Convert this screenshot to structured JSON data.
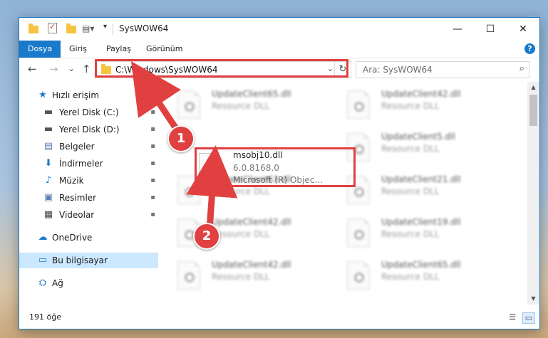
{
  "window": {
    "title": "SysWOW64",
    "minimize_symbol": "—",
    "maximize_symbol": "☐",
    "close_symbol": "✕"
  },
  "ribbon": {
    "tabs": [
      "Dosya",
      "Giriş",
      "Paylaş",
      "Görünüm"
    ],
    "active_tab": "Dosya",
    "help": "?"
  },
  "nav": {
    "back": "←",
    "forward": "→",
    "recent": "⌄",
    "up": "↑",
    "address": "C:\\Windows\\SysWOW64",
    "refresh": "↻",
    "dropdown": "⌄"
  },
  "search": {
    "placeholder": "Ara: SysWOW64",
    "icon": "⌕"
  },
  "sidebar": {
    "items": [
      {
        "label": "Hızlı erişim",
        "icon": "star-icon",
        "glyph": "★",
        "color": "#1979ca",
        "pinned": false
      },
      {
        "label": "Yerel Disk (C:)",
        "icon": "drive-icon",
        "glyph": "▬",
        "color": "#555555",
        "pinned": true
      },
      {
        "label": "Yerel Disk (D:)",
        "icon": "drive-icon",
        "glyph": "▬",
        "color": "#555555",
        "pinned": true
      },
      {
        "label": "Belgeler",
        "icon": "documents-icon",
        "glyph": "▤",
        "color": "#5a7fb3",
        "pinned": true
      },
      {
        "label": "İndirmeler",
        "icon": "downloads-icon",
        "glyph": "⬇",
        "color": "#1979ca",
        "pinned": true
      },
      {
        "label": "Müzik",
        "icon": "music-icon",
        "glyph": "♪",
        "color": "#1979ca",
        "pinned": true
      },
      {
        "label": "Resimler",
        "icon": "pictures-icon",
        "glyph": "▣",
        "color": "#5a7fb3",
        "pinned": true
      },
      {
        "label": "Videolar",
        "icon": "videos-icon",
        "glyph": "▦",
        "color": "#444444",
        "pinned": true
      },
      {
        "label": "OneDrive",
        "icon": "onedrive-icon",
        "glyph": "☁",
        "color": "#1979ca",
        "pinned": false
      },
      {
        "label": "Bu bilgisayar",
        "icon": "computer-icon",
        "glyph": "▭",
        "color": "#2b79c2",
        "pinned": false
      },
      {
        "label": "Ağ",
        "icon": "network-icon",
        "glyph": "⛭",
        "color": "#2b79c2",
        "pinned": false
      }
    ],
    "pin_glyph": "📌"
  },
  "files": {
    "highlighted": {
      "name": "msobj10.dll",
      "version": "6.0.8168.0",
      "description": "Microsoft (R) Objec..."
    },
    "blurred": [
      {
        "name": "UpdateClient65.dll",
        "type": "Resource DLL"
      },
      {
        "name": "UpdateClient42.dll",
        "type": "Resource DLL"
      },
      {
        "name": "UpdateClient5.dll",
        "type": "Resource DLL"
      },
      {
        "name": "UpdateClient63.dll",
        "type": "Resource DLL"
      },
      {
        "name": "UpdateClient21.dll",
        "type": "Resource DLL"
      },
      {
        "name": "UpdateClient42.dll",
        "type": "Resource DLL"
      },
      {
        "name": "UpdateClient19.dll",
        "type": "Resource DLL"
      },
      {
        "name": "UpdateClient42.dll",
        "type": "Resource DLL"
      },
      {
        "name": "UpdateClient65.dll",
        "type": "Resource DLL"
      }
    ]
  },
  "status": {
    "count": "191 öğe"
  },
  "callouts": {
    "step1": "1",
    "step2": "2",
    "color": "#e0403f"
  }
}
